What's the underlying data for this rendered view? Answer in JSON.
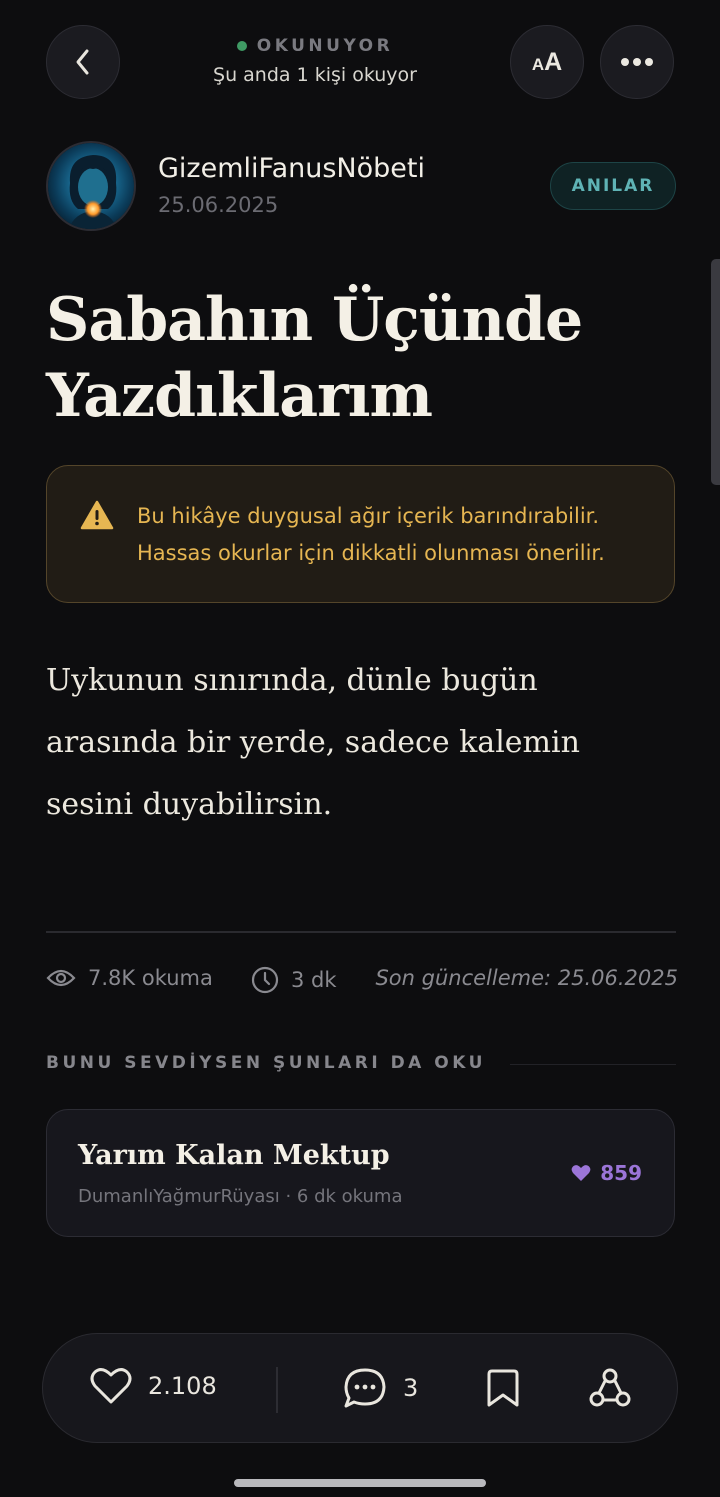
{
  "status": {
    "label": "OKUNUYOR",
    "readers_text": "Şu anda 1 kişi okuyor"
  },
  "toolbar": {
    "font_size_label_small": "A",
    "font_size_label_large": "A"
  },
  "author": {
    "name": "GizemliFanusNöbeti",
    "date": "25.06.2025",
    "tag": "ANILAR"
  },
  "story": {
    "title_line1": "Sabahın Üçünde",
    "title_line2": "Yazdıklarım",
    "warning_line1": "Bu hikâye duygusal ağır içerik barındırabilir.",
    "warning_line2": "Hassas okurlar için dikkatli olunması önerilir.",
    "body_line1": "Uykunun sınırında, dünle bugün",
    "body_line2": "arasında bir yerde, sadece kalemin",
    "body_line3": "sesini duyabilirsin."
  },
  "stats": {
    "reads": "7.8K okuma",
    "duration": "3 dk",
    "updated": "Son güncelleme: 25.06.2025"
  },
  "recommendations": {
    "section_title": "BUNU SEVDİYSEN ŞUNLARI DA OKU",
    "items": [
      {
        "title": "Yarım Kalan Mektup",
        "meta": "DumanlıYağmurRüyası · 6 dk okuma",
        "likes": "859"
      }
    ]
  },
  "actions": {
    "likes": "2.108",
    "comments": "3"
  },
  "colors": {
    "background": "#0d0d0f",
    "accent_teal": "#5fb3b5",
    "warning_amber": "#e6b652",
    "like_purple": "#9b75d8",
    "online_green": "#3f9a64"
  },
  "icons": [
    "back-arrow-icon",
    "font-size-icon",
    "more-dots-icon",
    "warning-triangle-icon",
    "eye-icon",
    "clock-icon",
    "heart-icon",
    "comment-icon",
    "bookmark-icon",
    "share-icon"
  ]
}
